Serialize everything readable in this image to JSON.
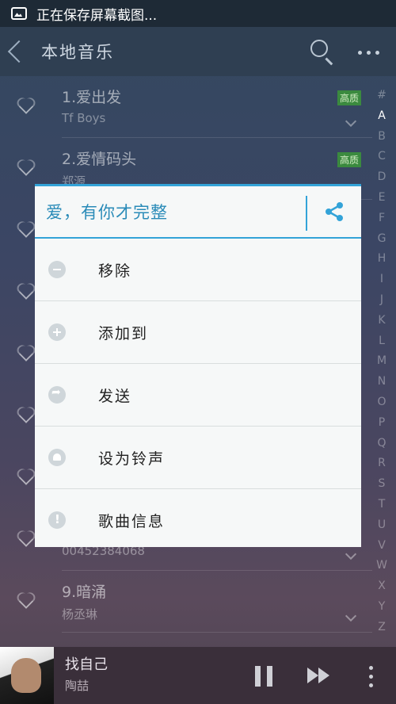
{
  "status_bar": {
    "text": "正在保存屏幕截图..."
  },
  "header": {
    "title": "本地音乐"
  },
  "songs": [
    {
      "title": "1.爱出发",
      "artist": "Tf Boys",
      "badge": "高质"
    },
    {
      "title": "2.爱情码头",
      "artist": "郑源",
      "badge": "高质"
    },
    {
      "title": "",
      "artist": "",
      "badge": ""
    },
    {
      "title": "",
      "artist": "",
      "badge": ""
    },
    {
      "title": "",
      "artist": "",
      "badge": ""
    },
    {
      "title": "",
      "artist": "",
      "badge": ""
    },
    {
      "title": "",
      "artist": "",
      "badge": ""
    },
    {
      "title": "",
      "artist": "00452384068",
      "badge": ""
    },
    {
      "title": "9.暗涌",
      "artist": "杨丞琳",
      "badge": ""
    }
  ],
  "index_letters": [
    "#",
    "A",
    "B",
    "C",
    "D",
    "E",
    "F",
    "G",
    "H",
    "I",
    "J",
    "K",
    "L",
    "M",
    "N",
    "O",
    "P",
    "Q",
    "R",
    "S",
    "T",
    "U",
    "V",
    "W",
    "X",
    "Y",
    "Z"
  ],
  "dialog": {
    "title": "爱，有你才完整",
    "items": [
      {
        "label": "移除",
        "icon": "minus-icon"
      },
      {
        "label": "添加到",
        "icon": "plus-icon"
      },
      {
        "label": "发送",
        "icon": "send-icon"
      },
      {
        "label": "设为铃声",
        "icon": "bell-icon"
      },
      {
        "label": "歌曲信息",
        "icon": "info-icon"
      }
    ]
  },
  "player": {
    "song": "找自己",
    "artist": "陶喆"
  }
}
